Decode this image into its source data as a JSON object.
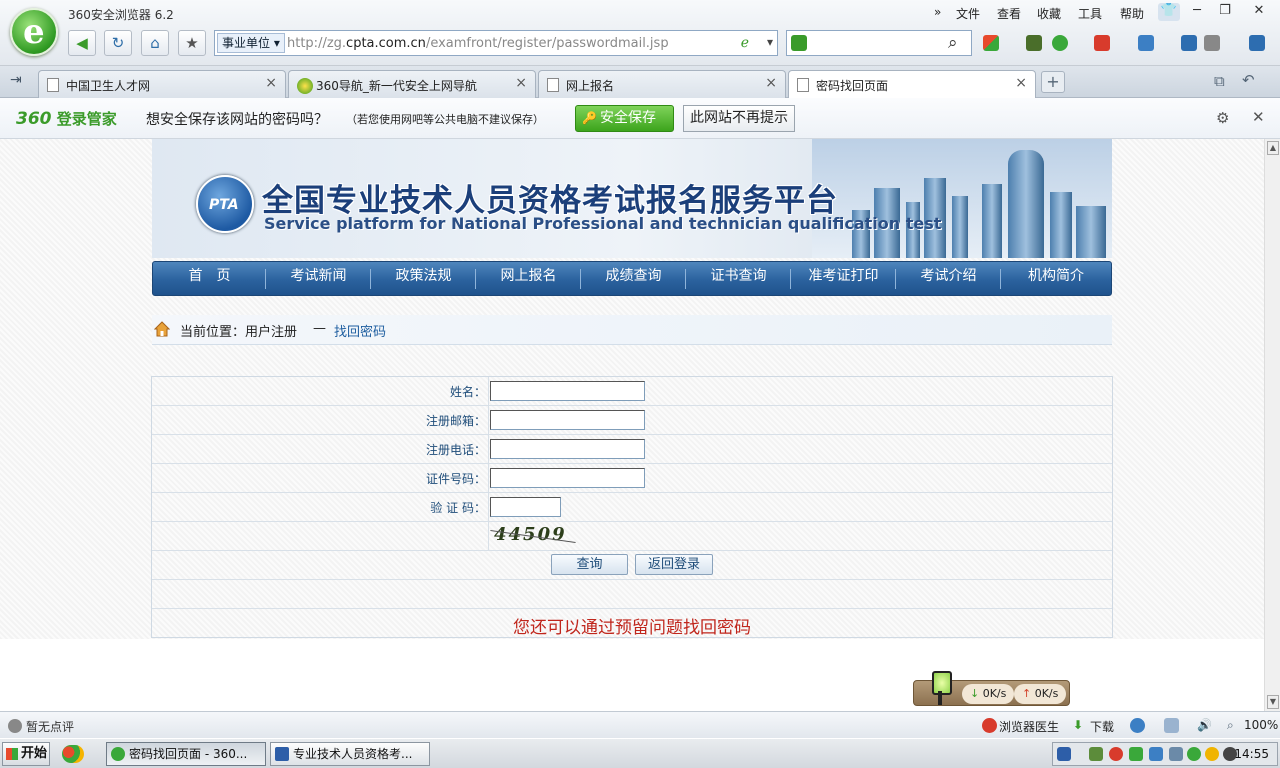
{
  "browser": {
    "app_title": "360安全浏览器 6.2",
    "menu": [
      "文件",
      "查看",
      "收藏",
      "工具",
      "帮助"
    ],
    "address": {
      "tag": "事业单位",
      "url_prefix": "http://zg.",
      "url_domain": "cpta.com.cn",
      "url_path": "/examfront/register/passwordmail.jsp"
    },
    "tabs": [
      {
        "label": "中国卫生人才网"
      },
      {
        "label": "360导航_新一代安全上网导航"
      },
      {
        "label": "网上报名"
      },
      {
        "label": "密码找回页面"
      }
    ],
    "password_bar": {
      "brand_num": "360",
      "brand_text": "登录管家",
      "message": "想安全保存该网站的密码吗？",
      "note": "（若您使用网吧等公共电脑不建议保存）",
      "save_button": "安全保存",
      "never_button": "此网站不再提示"
    },
    "status": {
      "left": "暂无点评",
      "doctor": "浏览器医生",
      "download": "下载",
      "zoom": "100%"
    },
    "speed": {
      "down": "0K/s",
      "up": "0K/s"
    }
  },
  "site": {
    "banner_logo": "PTA",
    "banner_title": "全国专业技术人员资格考试报名服务平台",
    "banner_subtitle": "Service platform for National Professional and technician  qualification test",
    "nav": [
      "首　页",
      "考试新闻",
      "政策法规",
      "网上报名",
      "成绩查询",
      "证书查询",
      "准考证打印",
      "考试介绍",
      "机构简介"
    ],
    "breadcrumb": {
      "label": "当前位置：用户注册",
      "separator": "—",
      "current": "找回密码"
    },
    "form": {
      "fields": [
        {
          "label": "姓名：",
          "value": ""
        },
        {
          "label": "注册邮箱：",
          "value": ""
        },
        {
          "label": "注册电话：",
          "value": ""
        },
        {
          "label": "证件号码：",
          "value": ""
        }
      ],
      "captcha_label": "验 证 码：",
      "captcha_value": "",
      "captcha_text": "44509",
      "query_button": "查询",
      "back_button": "返回登录",
      "recover_link": "您还可以通过预留问题找回密码"
    }
  },
  "taskbar": {
    "start": "开始",
    "tasks": [
      {
        "label": "密码找回页面 - 360..."
      },
      {
        "label": "专业技术人员资格考..."
      }
    ],
    "clock": "14:55"
  }
}
